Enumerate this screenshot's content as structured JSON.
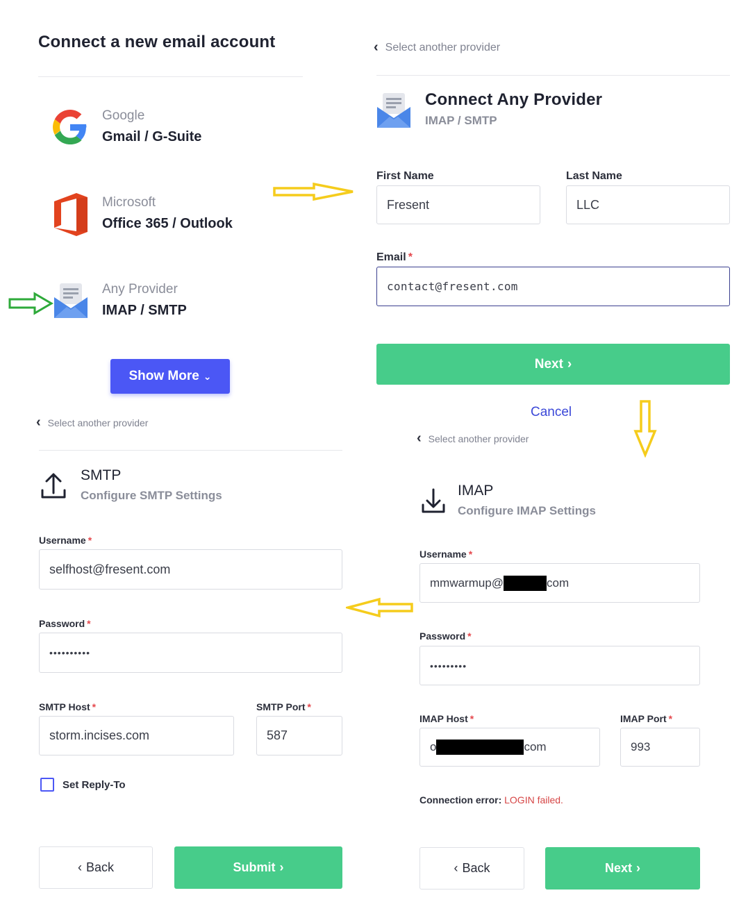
{
  "panel_connect": {
    "title": "Connect a new email account",
    "providers": [
      {
        "category": "Google",
        "name": "Gmail / G-Suite",
        "icon": "google-icon"
      },
      {
        "category": "Microsoft",
        "name": "Office 365 / Outlook",
        "icon": "office-icon"
      },
      {
        "category": "Any Provider",
        "name": "IMAP / SMTP",
        "icon": "envelope-icon"
      }
    ],
    "show_more_label": "Show More"
  },
  "panel_any": {
    "back_label": "Select another provider",
    "title": "Connect Any Provider",
    "subtitle": "IMAP / SMTP",
    "first_name_label": "First Name",
    "first_name_value": "Fresent",
    "last_name_label": "Last Name",
    "last_name_value": "LLC",
    "email_label": "Email",
    "email_value": "contact@fresent.com",
    "next_label": "Next",
    "cancel_label": "Cancel"
  },
  "panel_smtp": {
    "back_label": "Select another provider",
    "title": "SMTP",
    "subtitle": "Configure SMTP Settings",
    "username_label": "Username",
    "username_value": "selfhost@fresent.com",
    "password_label": "Password",
    "password_value": "••••••••••",
    "host_label": "SMTP Host",
    "host_value": "storm.incises.com",
    "port_label": "SMTP Port",
    "port_value": "587",
    "reply_to_label": "Set Reply-To",
    "back_button": "Back",
    "submit_button": "Submit"
  },
  "panel_imap": {
    "back_label": "Select another provider",
    "title": "IMAP",
    "subtitle": "Configure IMAP Settings",
    "username_label": "Username",
    "username_prefix": "mmwarmup@",
    "username_suffix": "com",
    "password_label": "Password",
    "password_value": "•••••••••",
    "host_label": "IMAP Host",
    "host_prefix": "o",
    "host_suffix": "com",
    "port_label": "IMAP Port",
    "port_value": "993",
    "error_prefix": "Connection error:",
    "error_text": "LOGIN failed.",
    "back_button": "Back",
    "next_button": "Next"
  },
  "colors": {
    "accent_green": "#47cc8a",
    "accent_blue": "#4b57f5",
    "annotation_yellow": "#f5cc1c",
    "annotation_green": "#2eaa3a",
    "error_red": "#e5484d"
  }
}
